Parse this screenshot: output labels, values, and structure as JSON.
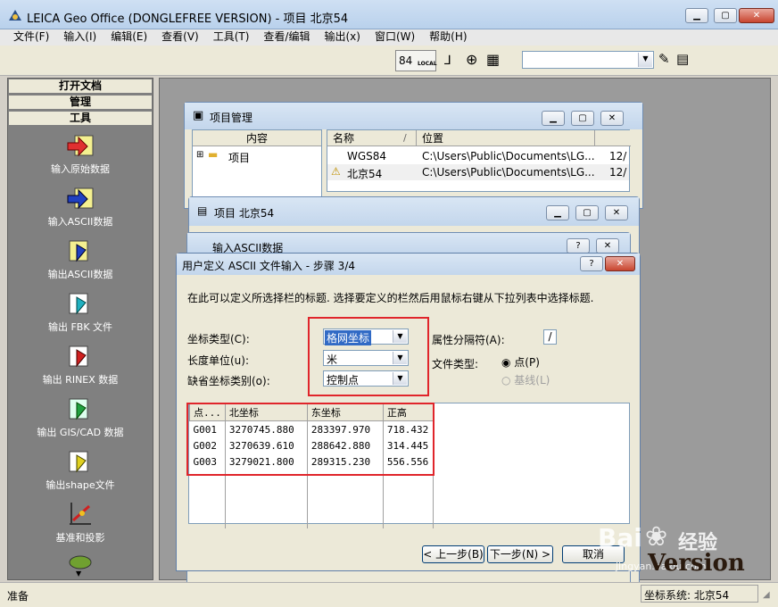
{
  "app": {
    "title": "LEICA Geo Office (DONGLEFREE VERSION) - 项目 北京54"
  },
  "menu": [
    "文件(F)",
    "输入(I)",
    "编辑(E)",
    "查看(V)",
    "工具(T)",
    "查看/编辑",
    "输出(x)",
    "窗口(W)",
    "帮助(H)"
  ],
  "toolbar": {
    "badge": "84",
    "badge_sub": "LOCAL",
    "combo_value": ""
  },
  "sidebar": {
    "tabs": [
      "打开文档",
      "管理",
      "工具"
    ],
    "tools": [
      "输入原始数据",
      "输入ASCII数据",
      "输出ASCII数据",
      "输出 FBK 文件",
      "输出 RINEX 数据",
      "输出 GIS/CAD 数据",
      "输出shape文件",
      "基准和投影"
    ]
  },
  "project_mgr": {
    "title": "项目管理",
    "tree_header": "内容",
    "tree_item": "项目",
    "columns": [
      "名称",
      "位置"
    ],
    "rows": [
      {
        "name": "WGS84",
        "path": "C:\\Users\\Public\\Documents\\LG...",
        "date": "12/"
      },
      {
        "name": "北京54",
        "path": "C:\\Users\\Public\\Documents\\LG...",
        "date": "12/"
      }
    ]
  },
  "project_win": {
    "title": "项目 北京54"
  },
  "ascii_win": {
    "title": "输入ASCII数据"
  },
  "dialog": {
    "title": "用户定义 ASCII 文件输入 - 步骤 3/4",
    "help": "?",
    "instruction": "在此可以定义所选择栏的标题. 选择要定义的栏然后用鼠标右键从下拉列表中选择标题.",
    "coord_type_label": "坐标类型(C):",
    "coord_type_value": "格网坐标",
    "length_unit_label": "长度单位(u):",
    "length_unit_value": "米",
    "default_class_label": "缺省坐标类别(o):",
    "default_class_value": "控制点",
    "separator_label": "属性分隔符(A):",
    "separator_value": "/",
    "file_type_label": "文件类型:",
    "radio_point": "点(P)",
    "radio_line": "基线(L)",
    "table": {
      "headers": [
        "点...",
        "北坐标",
        "东坐标",
        "正高"
      ],
      "rows": [
        [
          "G001",
          "3270745.880",
          "283397.970",
          "718.432"
        ],
        [
          "G002",
          "3270639.610",
          "288642.880",
          "314.445"
        ],
        [
          "G003",
          "3279021.800",
          "289315.230",
          "556.556"
        ]
      ]
    },
    "back_button": "< 上一步(B)",
    "next_button": "下一步(N) >",
    "cancel_button": "取消"
  },
  "status": {
    "left": "准备",
    "right": "坐标系统: 北京54"
  },
  "watermark": {
    "logo": "Bai",
    "logo2": "经验",
    "url": "jingyan.baidu.com",
    "text": "Version"
  }
}
